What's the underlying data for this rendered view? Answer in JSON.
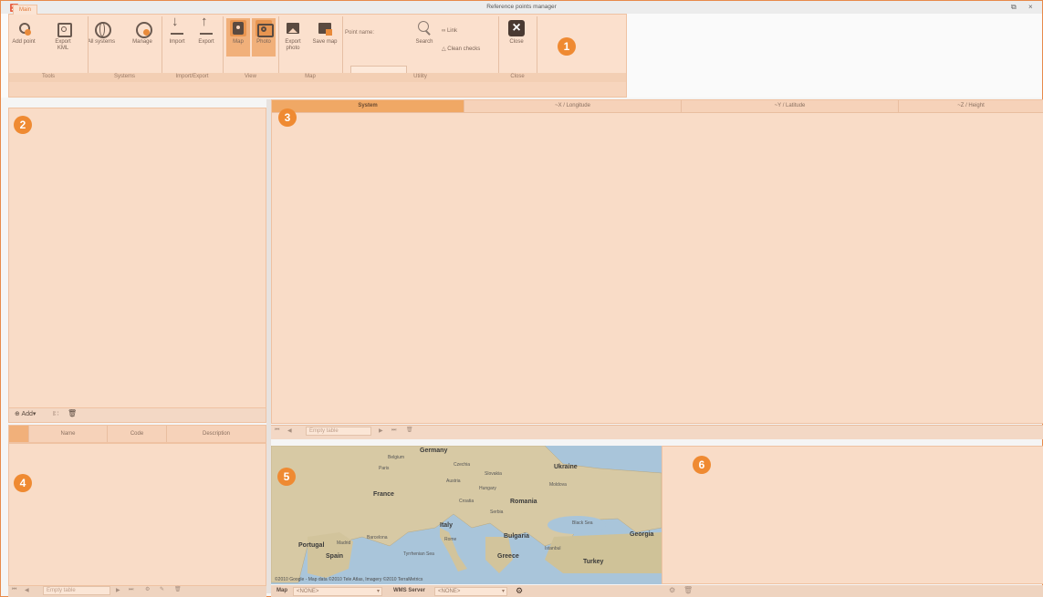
{
  "window": {
    "title": "Reference points manager",
    "restore": "⧉",
    "close": "×"
  },
  "ribbon": {
    "tab": "Main",
    "buttons": {
      "add_point": "Add point",
      "export_kml": "Export KML",
      "all_systems": "All systems",
      "manage": "Manage",
      "import": "Import",
      "export": "Export",
      "map": "Map",
      "photo": "Photo",
      "export_photo": "Export photo",
      "save_map": "Save map",
      "search": "Search",
      "close": "Close"
    },
    "point_name_label": "Point name:",
    "link": "Link",
    "clean_checks": "Clean checks",
    "groups": [
      "Tools",
      "Systems",
      "Import/Export",
      "View",
      "Map",
      "Utility",
      "Close"
    ]
  },
  "badges": [
    "1",
    "2",
    "3",
    "4",
    "5",
    "6"
  ],
  "grid": {
    "columns": [
      "System",
      "~X / Longitude",
      "~Y / Latitude",
      "~Z / Height"
    ],
    "empty_label": "Empty table"
  },
  "left_toolbar": {
    "add": "Add",
    "add_dropdown": "▾",
    "rename": "I∷",
    "delete": "🗑"
  },
  "left_columns": [
    "",
    "Name",
    "Code",
    "Description"
  ],
  "map": {
    "attribution": "©2010 Google - Map data ©2010 Tele Atlas, Imagery ©2010 TerraMetrics",
    "labels": [
      "Germany",
      "Belgium",
      "Czechia",
      "Slovakia",
      "Paris",
      "Austria",
      "Hungary",
      "Ukraine",
      "Moldova",
      "France",
      "Croatia",
      "Romania",
      "Serbia",
      "Black Sea",
      "Italy",
      "Bulgaria",
      "Georgia",
      "Portugal",
      "Madrid",
      "Spain",
      "Barcelona",
      "Rome",
      "Istanbul",
      "Greece",
      "Turkey",
      "Tyrrhenian Sea"
    ],
    "map_label": "Map",
    "map_value": "<NONE>",
    "wms_label": "WMS Server",
    "wms_value": "<NONE>"
  }
}
